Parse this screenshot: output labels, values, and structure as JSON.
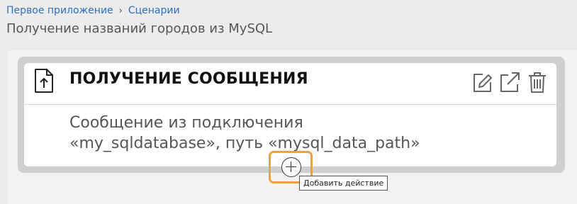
{
  "breadcrumb": {
    "items": [
      {
        "label": "Первое приложение"
      },
      {
        "label": "Сценарии"
      }
    ],
    "separator": "›"
  },
  "page": {
    "title": "Получение названий городов из MySQL"
  },
  "card": {
    "icon": "file-upload-icon",
    "title": "ПОЛУЧЕНИЕ СООБЩЕНИЯ",
    "body_line1": "Сообщение из подключения",
    "body_line2": "«my_sqldatabase», путь «mysql_data_path»",
    "actions": [
      "edit-icon",
      "open-external-icon",
      "trash-icon"
    ]
  },
  "add_action": {
    "icon": "plus-circle-icon",
    "tooltip": "Добавить действие"
  },
  "colors": {
    "link": "#2c6fb7",
    "highlight": "#f0a040",
    "card_frame": "#cfcfcf"
  }
}
